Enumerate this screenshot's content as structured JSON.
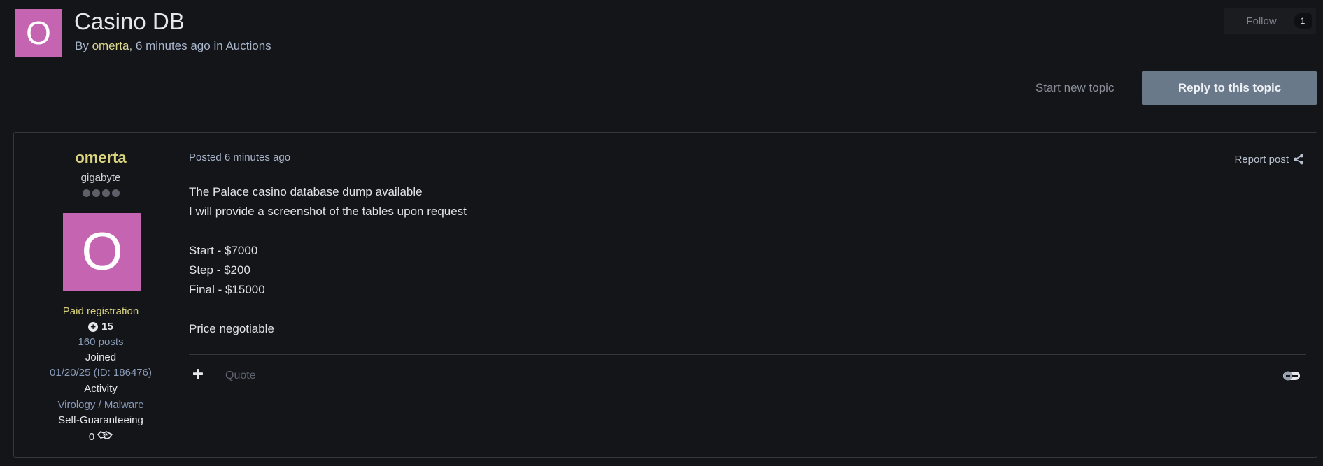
{
  "topic": {
    "avatar_letter": "O",
    "avatar_color": "#c564b0",
    "title": "Casino DB",
    "meta_prefix": "By ",
    "author": "omerta",
    "meta_suffix": ", 6 minutes ago in Auctions"
  },
  "follow": {
    "label": "Follow",
    "count": "1"
  },
  "actions": {
    "start_topic": "Start new topic",
    "reply": "Reply to this topic"
  },
  "post": {
    "author": {
      "name": "omerta",
      "title": "gigabyte",
      "rank_dots": 4,
      "avatar_letter": "O",
      "group": "Paid registration",
      "reputation": "15",
      "posts": "160 posts",
      "joined_label": "Joined",
      "joined_value": "01/20/25 (ID: 186476)",
      "activity_label": "Activity",
      "activity_value": "Virology / Malware",
      "guarantee_label": "Self-Guaranteeing",
      "deals_count": "0"
    },
    "posted": "Posted 6 minutes ago",
    "report": "Report post",
    "body": [
      "The Palace casino database dump available",
      "I will provide a screenshot of the tables upon request",
      "",
      "Start - $7000",
      "Step - $200",
      "Final - $15000",
      "",
      "Price negotiable"
    ],
    "quote_label": "Quote"
  },
  "colors": {
    "background": "#141519",
    "accent_yellow": "#d9d37e",
    "link_blue": "#a9b6cc",
    "reply_button": "#6a7989",
    "avatar": "#c564b0"
  },
  "icons": {
    "share": "share-icon",
    "add": "plus-icon",
    "reputation": "plus-circle-icon",
    "deals": "handshake-icon",
    "rep_toggle": "reputation-toggle-icon"
  }
}
